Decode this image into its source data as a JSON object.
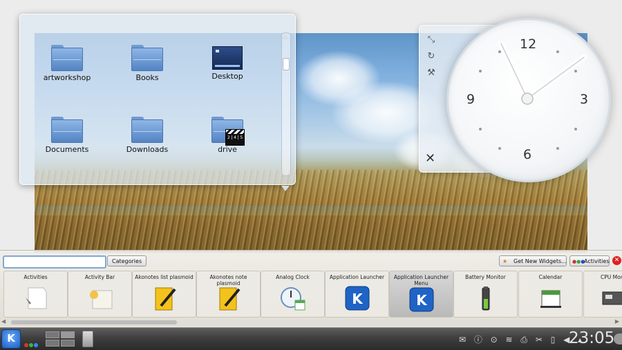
{
  "folderview": {
    "items": [
      {
        "label": "artworkshop",
        "icon": "folder-icon"
      },
      {
        "label": "Books",
        "icon": "folder-icon"
      },
      {
        "label": "Desktop",
        "icon": "desktop-icon"
      },
      {
        "label": "Documents",
        "icon": "folder-icon"
      },
      {
        "label": "Downloads",
        "icon": "folder-icon"
      },
      {
        "label": "drive",
        "icon": "video-folder-icon"
      }
    ]
  },
  "clock": {
    "numerals": [
      "12",
      "3",
      "6",
      "9"
    ],
    "handles": [
      "resize-icon",
      "rotate-icon",
      "settings-icon"
    ],
    "close_icon": "close-icon",
    "time_shown": "23:05"
  },
  "explorer": {
    "search_placeholder": "",
    "categories_label": "Categories",
    "get_new_widgets_label": "Get New Widgets...",
    "activities_label": "Activities",
    "widgets": [
      {
        "name": "Activities",
        "icon": "activities-icon"
      },
      {
        "name": "Activity Bar",
        "icon": "activity-bar-icon"
      },
      {
        "name": "Akonotes list plasmoid",
        "icon": "notepad-icon"
      },
      {
        "name": "Akonotes note plasmoid",
        "icon": "notepad-icon"
      },
      {
        "name": "Analog Clock",
        "icon": "clock-icon"
      },
      {
        "name": "Application Launcher",
        "icon": "kde-icon"
      },
      {
        "name": "Application Launcher Menu",
        "icon": "kde-icon"
      },
      {
        "name": "Battery Monitor",
        "icon": "battery-icon"
      },
      {
        "name": "Calendar",
        "icon": "calendar-icon"
      },
      {
        "name": "CPU Mon",
        "icon": "cpu-icon"
      }
    ]
  },
  "taskbar": {
    "time": "23:05",
    "kmenu_glyph": "K",
    "tray_icons": [
      "klipper-icon",
      "notifications-icon",
      "device-icon",
      "network-icon",
      "printer-icon",
      "cut-icon",
      "battery-icon",
      "volume-icon",
      "arrow-icon"
    ],
    "tray_glyphs": "✉ ⓘ ⊙ ≋ ⎙ ✂ ▯ ◀ ▴"
  },
  "colors": {
    "accent": "#7fa6d8",
    "taskbar": "#3e3e3e",
    "close_red": "#dd2222"
  }
}
